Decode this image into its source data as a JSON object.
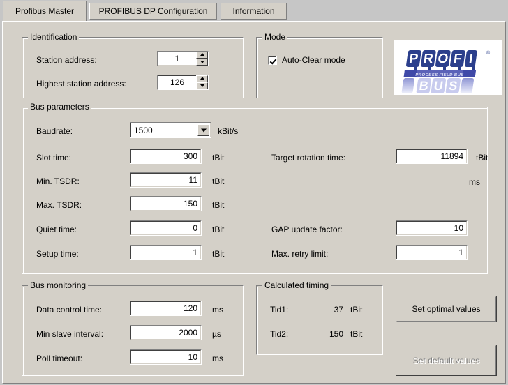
{
  "tabs": [
    {
      "label": "Profibus Master",
      "active": true
    },
    {
      "label": "PROFIBUS DP Configuration",
      "active": false
    },
    {
      "label": "Information",
      "active": false
    }
  ],
  "identification": {
    "title": "Identification",
    "station_address": {
      "label": "Station address:",
      "value": "1"
    },
    "highest_station_address": {
      "label": "Highest station address:",
      "value": "126"
    }
  },
  "mode": {
    "title": "Mode",
    "auto_clear": {
      "label": "Auto-Clear mode",
      "checked": true
    }
  },
  "logo": {
    "top_text": "PROFI",
    "bottom_text": "BUS",
    "tagline": "PROCESS FIELD BUS",
    "trademark": "®",
    "color_dark": "#2b3f8c",
    "color_mid": "#6f74c4",
    "color_light": "#a9aee0",
    "color_band": "#5b62b8"
  },
  "bus_parameters": {
    "title": "Bus parameters",
    "baudrate": {
      "label": "Baudrate:",
      "value": "1500",
      "unit": "kBit/s"
    },
    "slot_time": {
      "label": "Slot time:",
      "value": "300",
      "unit": "tBit"
    },
    "min_tsdr": {
      "label": "Min. TSDR:",
      "value": "11",
      "unit": "tBit"
    },
    "max_tsdr": {
      "label": "Max. TSDR:",
      "value": "150",
      "unit": "tBit"
    },
    "quiet_time": {
      "label": "Quiet time:",
      "value": "0",
      "unit": "tBit"
    },
    "setup_time": {
      "label": "Setup time:",
      "value": "1",
      "unit": "tBit"
    },
    "target_rotation_time": {
      "label": "Target rotation time:",
      "value": "11894",
      "unit": "tBit"
    },
    "equals_row": {
      "symbol": "=",
      "value": "",
      "unit": "ms"
    },
    "gap_update_factor": {
      "label": "GAP update factor:",
      "value": "10"
    },
    "max_retry_limit": {
      "label": "Max. retry limit:",
      "value": "1"
    }
  },
  "bus_monitoring": {
    "title": "Bus monitoring",
    "data_control_time": {
      "label": "Data control time:",
      "value": "120",
      "unit": "ms"
    },
    "min_slave_interval": {
      "label": "Min slave interval:",
      "value": "2000",
      "unit": "µs"
    },
    "poll_timeout": {
      "label": "Poll timeout:",
      "value": "10",
      "unit": "ms"
    }
  },
  "calculated_timing": {
    "title": "Calculated timing",
    "tid1": {
      "label": "Tid1:",
      "value": "37",
      "unit": "tBit"
    },
    "tid2": {
      "label": "Tid2:",
      "value": "150",
      "unit": "tBit"
    }
  },
  "buttons": {
    "set_optimal": {
      "label": "Set optimal values",
      "enabled": true
    },
    "set_default": {
      "label": "Set default values",
      "enabled": false
    }
  }
}
